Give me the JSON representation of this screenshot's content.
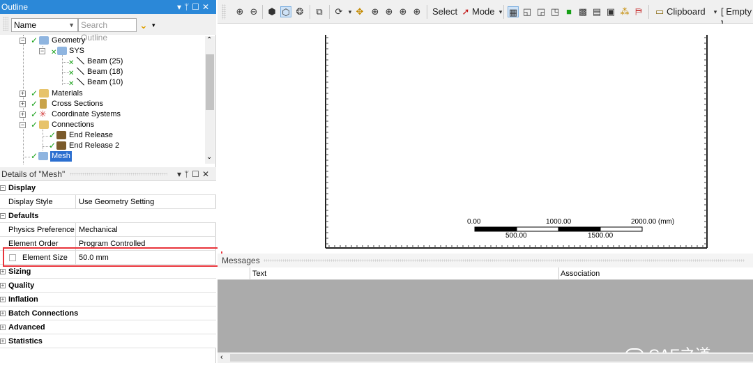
{
  "outline": {
    "title": "Outline",
    "controls": "▾ ⬇ ☐ ✕",
    "name_column": "Name",
    "search_placeholder": "Search Outline",
    "tree": {
      "geometry": "Geometry",
      "sys": "SYS",
      "beam1": "Beam (25)",
      "beam2": "Beam (18)",
      "beam3": "Beam (10)",
      "materials": "Materials",
      "cross_sections": "Cross Sections",
      "coordinate_systems": "Coordinate Systems",
      "connections": "Connections",
      "end_release": "End Release",
      "end_release_2": "End Release 2",
      "mesh": "Mesh"
    }
  },
  "details": {
    "title": "Details of \"Mesh\"",
    "groups": {
      "display": "Display",
      "defaults": "Defaults",
      "sizing": "Sizing",
      "quality": "Quality",
      "inflation": "Inflation",
      "batch_connections": "Batch Connections",
      "advanced": "Advanced",
      "statistics": "Statistics"
    },
    "props": {
      "display_style_label": "Display Style",
      "display_style_value": "Use Geometry Setting",
      "physics_pref_label": "Physics Preference",
      "physics_pref_value": "Mechanical",
      "element_order_label": "Element Order",
      "element_order_value": "Program Controlled",
      "element_size_label": "Element Size",
      "element_size_value": "50.0 mm"
    }
  },
  "toolbar": {
    "select_label": "Select",
    "mode_label": "Mode",
    "clipboard_label": "Clipboard",
    "empty_label": "[ Empty ]"
  },
  "scale_bar": {
    "top_labels": [
      "0.00",
      "1000.00",
      "2000.00 (mm)"
    ],
    "bottom_labels": [
      "500.00",
      "1500.00"
    ]
  },
  "messages": {
    "title": "Messages",
    "col_text": "Text",
    "col_association": "Association"
  },
  "watermark": "CAE之道",
  "colors": {
    "accent": "#2b88d8",
    "check": "#16a016",
    "highlight": "#e8333a",
    "messages_bg": "#ababab"
  }
}
